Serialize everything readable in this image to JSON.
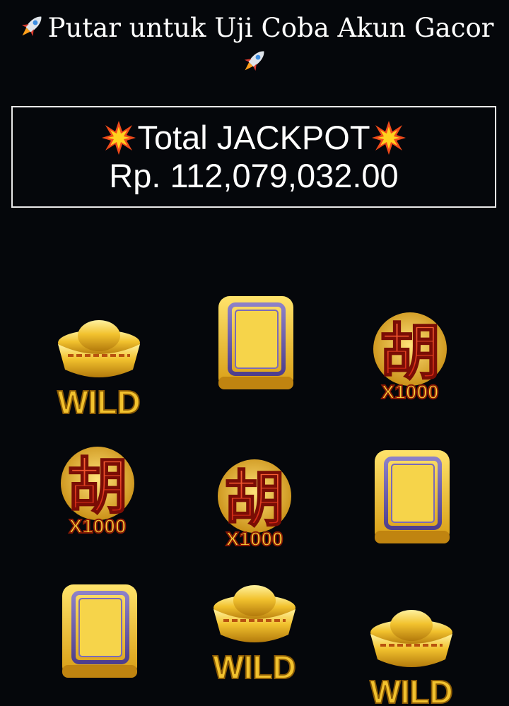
{
  "header": {
    "title": "Putar untuk Uji Coba Akun Gacor",
    "leading_icon": "rocket-icon",
    "trailing_icon": "rocket-icon"
  },
  "jackpot": {
    "title": "Total JACKPOT",
    "amount": "Rp. 112,079,032.00",
    "icon": "explosion-icon"
  },
  "slot_grid": {
    "rows": [
      [
        {
          "symbol": "wild-ingot",
          "label": "WILD"
        },
        {
          "symbol": "blank-tile",
          "label": ""
        },
        {
          "symbol": "hu-x1000",
          "label": "X1000"
        }
      ],
      [
        {
          "symbol": "hu-x1000",
          "label": "X1000"
        },
        {
          "symbol": "hu-x1000",
          "label": "X1000"
        },
        {
          "symbol": "blank-tile",
          "label": ""
        }
      ],
      [
        {
          "symbol": "blank-tile",
          "label": ""
        },
        {
          "symbol": "wild-ingot",
          "label": "WILD"
        },
        {
          "symbol": "wild-ingot",
          "label": "WILD"
        }
      ]
    ],
    "hu_glyph": "胡"
  },
  "colors": {
    "background": "#05070b",
    "gold": "#e8b923",
    "red": "#e8321a",
    "tile_purple": "#6a5aa8"
  }
}
